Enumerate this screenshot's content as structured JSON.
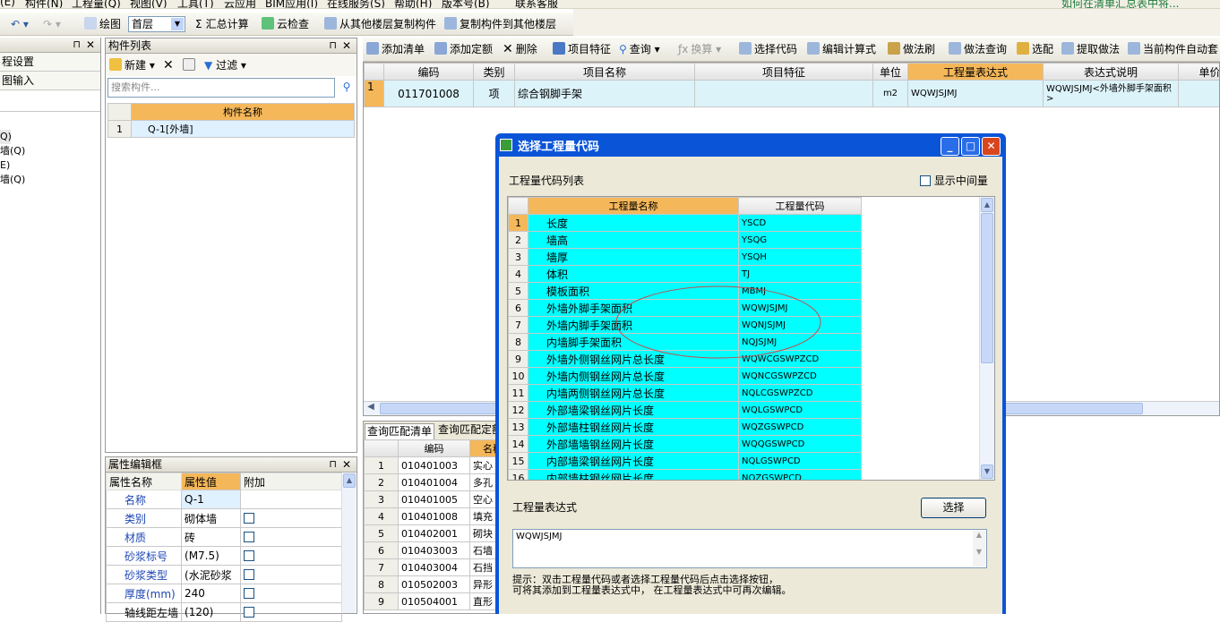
{
  "menu": {
    "items": [
      "(E)",
      "构件(N)",
      "工程量(Q)",
      "视图(V)",
      "工具(T)",
      "云应用",
      "BIM应用(I)",
      "在线服务(S)",
      "帮助(H)",
      "版本号(B)",
      "联系客服"
    ],
    "help_link": "如何在清单汇总表中将..."
  },
  "toolbar1": {
    "draw": "绘图",
    "floor": "首层",
    "summary": "汇总计算",
    "cloud_check": "云检查",
    "copy_from": "从其他楼层复制构件",
    "copy_to": "复制构件到其他楼层"
  },
  "left_pane": {
    "items": [
      "程设置",
      "图输入"
    ],
    "tree": [
      "Q)",
      "墙(Q)",
      "E)",
      "墙(Q)"
    ]
  },
  "component_list": {
    "title": "构件列表",
    "new": "新建",
    "filter": "过滤",
    "search_placeholder": "搜索构件...",
    "header": "构件名称",
    "rows": [
      {
        "no": "1",
        "name": "Q-1[外墙]"
      }
    ]
  },
  "props": {
    "title": "属性编辑框",
    "headers": [
      "属性名称",
      "属性值",
      "附加"
    ],
    "rows": [
      {
        "name": "名称",
        "value": "Q-1"
      },
      {
        "name": "类别",
        "value": "砌体墙"
      },
      {
        "name": "材质",
        "value": "砖"
      },
      {
        "name": "砂浆标号",
        "value": "(M7.5)"
      },
      {
        "name": "砂浆类型",
        "value": "(水泥砂浆"
      },
      {
        "name": "厚度(mm)",
        "value": "240"
      },
      {
        "name": "轴线距左墙",
        "value": "(120)"
      }
    ]
  },
  "toolbar2": {
    "add_list": "添加清单",
    "add_quota": "添加定额",
    "delete": "删除",
    "features": "项目特征",
    "query": "查询",
    "convert": "换算",
    "select_code": "选择代码",
    "edit_formula": "编辑计算式",
    "method_brush": "做法刷",
    "method_query": "做法查询",
    "pick": "选配",
    "extract": "提取做法",
    "auto": "当前构件自动套"
  },
  "main_table": {
    "headers": [
      "编码",
      "类别",
      "项目名称",
      "项目特征",
      "单位",
      "工程量表达式",
      "表达式说明",
      "单价"
    ],
    "rows": [
      {
        "no": "1",
        "code": "011701008",
        "type": "项",
        "name": "综合钢脚手架",
        "feature": "",
        "unit": "m2",
        "expr": "WQWJSJMJ",
        "desc": "WQWJSJMJ<外墙外脚手架面积>"
      }
    ]
  },
  "bottom": {
    "tabs": [
      "查询匹配清单",
      "查询匹配定额"
    ],
    "header_code": "编码",
    "header_name": "名称",
    "rows": [
      {
        "no": "1",
        "code": "010401003",
        "name": "实心"
      },
      {
        "no": "2",
        "code": "010401004",
        "name": "多孔"
      },
      {
        "no": "3",
        "code": "010401005",
        "name": "空心"
      },
      {
        "no": "4",
        "code": "010401008",
        "name": "填充"
      },
      {
        "no": "5",
        "code": "010402001",
        "name": "砌块"
      },
      {
        "no": "6",
        "code": "010403003",
        "name": "石墙"
      },
      {
        "no": "7",
        "code": "010403004",
        "name": "石挡"
      },
      {
        "no": "8",
        "code": "010502003",
        "name": "异形"
      },
      {
        "no": "9",
        "code": "010504001",
        "name": "直形"
      }
    ]
  },
  "dialog": {
    "title": "选择工程量代码",
    "list_label": "工程量代码列表",
    "show_intermediate": "显示中间量",
    "col_name": "工程量名称",
    "col_code": "工程量代码",
    "rows": [
      {
        "no": "1",
        "name": "长度",
        "code": "YSCD"
      },
      {
        "no": "2",
        "name": "墙高",
        "code": "YSQG"
      },
      {
        "no": "3",
        "name": "墙厚",
        "code": "YSQH"
      },
      {
        "no": "4",
        "name": "体积",
        "code": "TJ"
      },
      {
        "no": "5",
        "name": "模板面积",
        "code": "MBMJ"
      },
      {
        "no": "6",
        "name": "外墙外脚手架面积",
        "code": "WQWJSJMJ"
      },
      {
        "no": "7",
        "name": "外墙内脚手架面积",
        "code": "WQNJSJMJ"
      },
      {
        "no": "8",
        "name": "内墙脚手架面积",
        "code": "NQJSJMJ"
      },
      {
        "no": "9",
        "name": "外墙外侧钢丝网片总长度",
        "code": "WQWCGSWPZCD"
      },
      {
        "no": "10",
        "name": "外墙内侧钢丝网片总长度",
        "code": "WQNCGSWPZCD"
      },
      {
        "no": "11",
        "name": "内墙两侧钢丝网片总长度",
        "code": "NQLCGSWPZCD"
      },
      {
        "no": "12",
        "name": "外部墙梁钢丝网片长度",
        "code": "WQLGSWPCD"
      },
      {
        "no": "13",
        "name": "外部墙柱钢丝网片长度",
        "code": "WQZGSWPCD"
      },
      {
        "no": "14",
        "name": "外部墙墙钢丝网片长度",
        "code": "WQQGSWPCD"
      },
      {
        "no": "15",
        "name": "内部墙梁钢丝网片长度",
        "code": "NQLGSWPCD"
      },
      {
        "no": "16",
        "name": "内部墙柱钢丝网片长度",
        "code": "NQZGSWPCD"
      }
    ],
    "expr_label": "工程量表达式",
    "select_button": "选择",
    "expr_value": "WQWJSJMJ",
    "hint1": "提示：双击工程量代码或者选择工程量代码后点击选择按钮，",
    "hint2": "可将其添加到工程量表达式中，  在工程量表达式中可再次编辑。"
  },
  "colors": {
    "cyan": "#00ffff",
    "highlight": "#f4b75a",
    "selected_row": "#dff0ff",
    "dialog_blue": "#0a54d8"
  }
}
